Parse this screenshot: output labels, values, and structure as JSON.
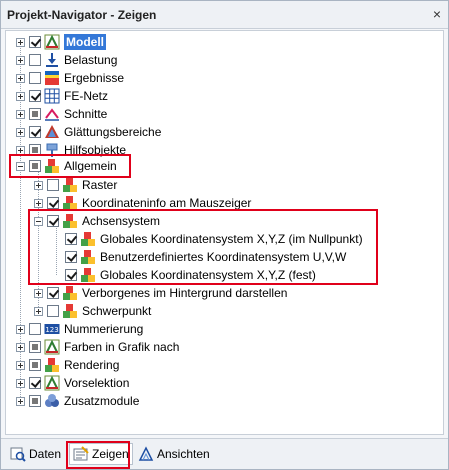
{
  "window": {
    "title": "Projekt-Navigator - Zeigen",
    "close_symbol": "×"
  },
  "tree": {
    "modell": "Modell",
    "belastung": "Belastung",
    "ergebnisse": "Ergebnisse",
    "fe_netz": "FE-Netz",
    "schnitte": "Schnitte",
    "glaettungsbereiche": "Glättungsbereiche",
    "hilfsobjekte": "Hilfsobjekte",
    "allgemein": "Allgemein",
    "raster": "Raster",
    "koordinateninfo": "Koordinateninfo am Mauszeiger",
    "achsensystem": "Achsensystem",
    "globales_null": "Globales Koordinatensystem X,Y,Z (im Nullpunkt)",
    "benutzerdefiniert": "Benutzerdefiniertes Koordinatensystem U,V,W",
    "globales_fest": "Globales Koordinatensystem X,Y,Z (fest)",
    "verborgenes": "Verborgenes im Hintergrund darstellen",
    "schwerpunkt": "Schwerpunkt",
    "nummerierung": "Nummerierung",
    "farben": "Farben in Grafik nach",
    "rendering": "Rendering",
    "vorselektion": "Vorselektion",
    "zusatzmodule": "Zusatzmodule"
  },
  "tabs": {
    "daten": "Daten",
    "zeigen": "Zeigen",
    "ansichten": "Ansichten"
  },
  "colors": {
    "selection": "#3478d8",
    "highlight": "#e0001a"
  }
}
